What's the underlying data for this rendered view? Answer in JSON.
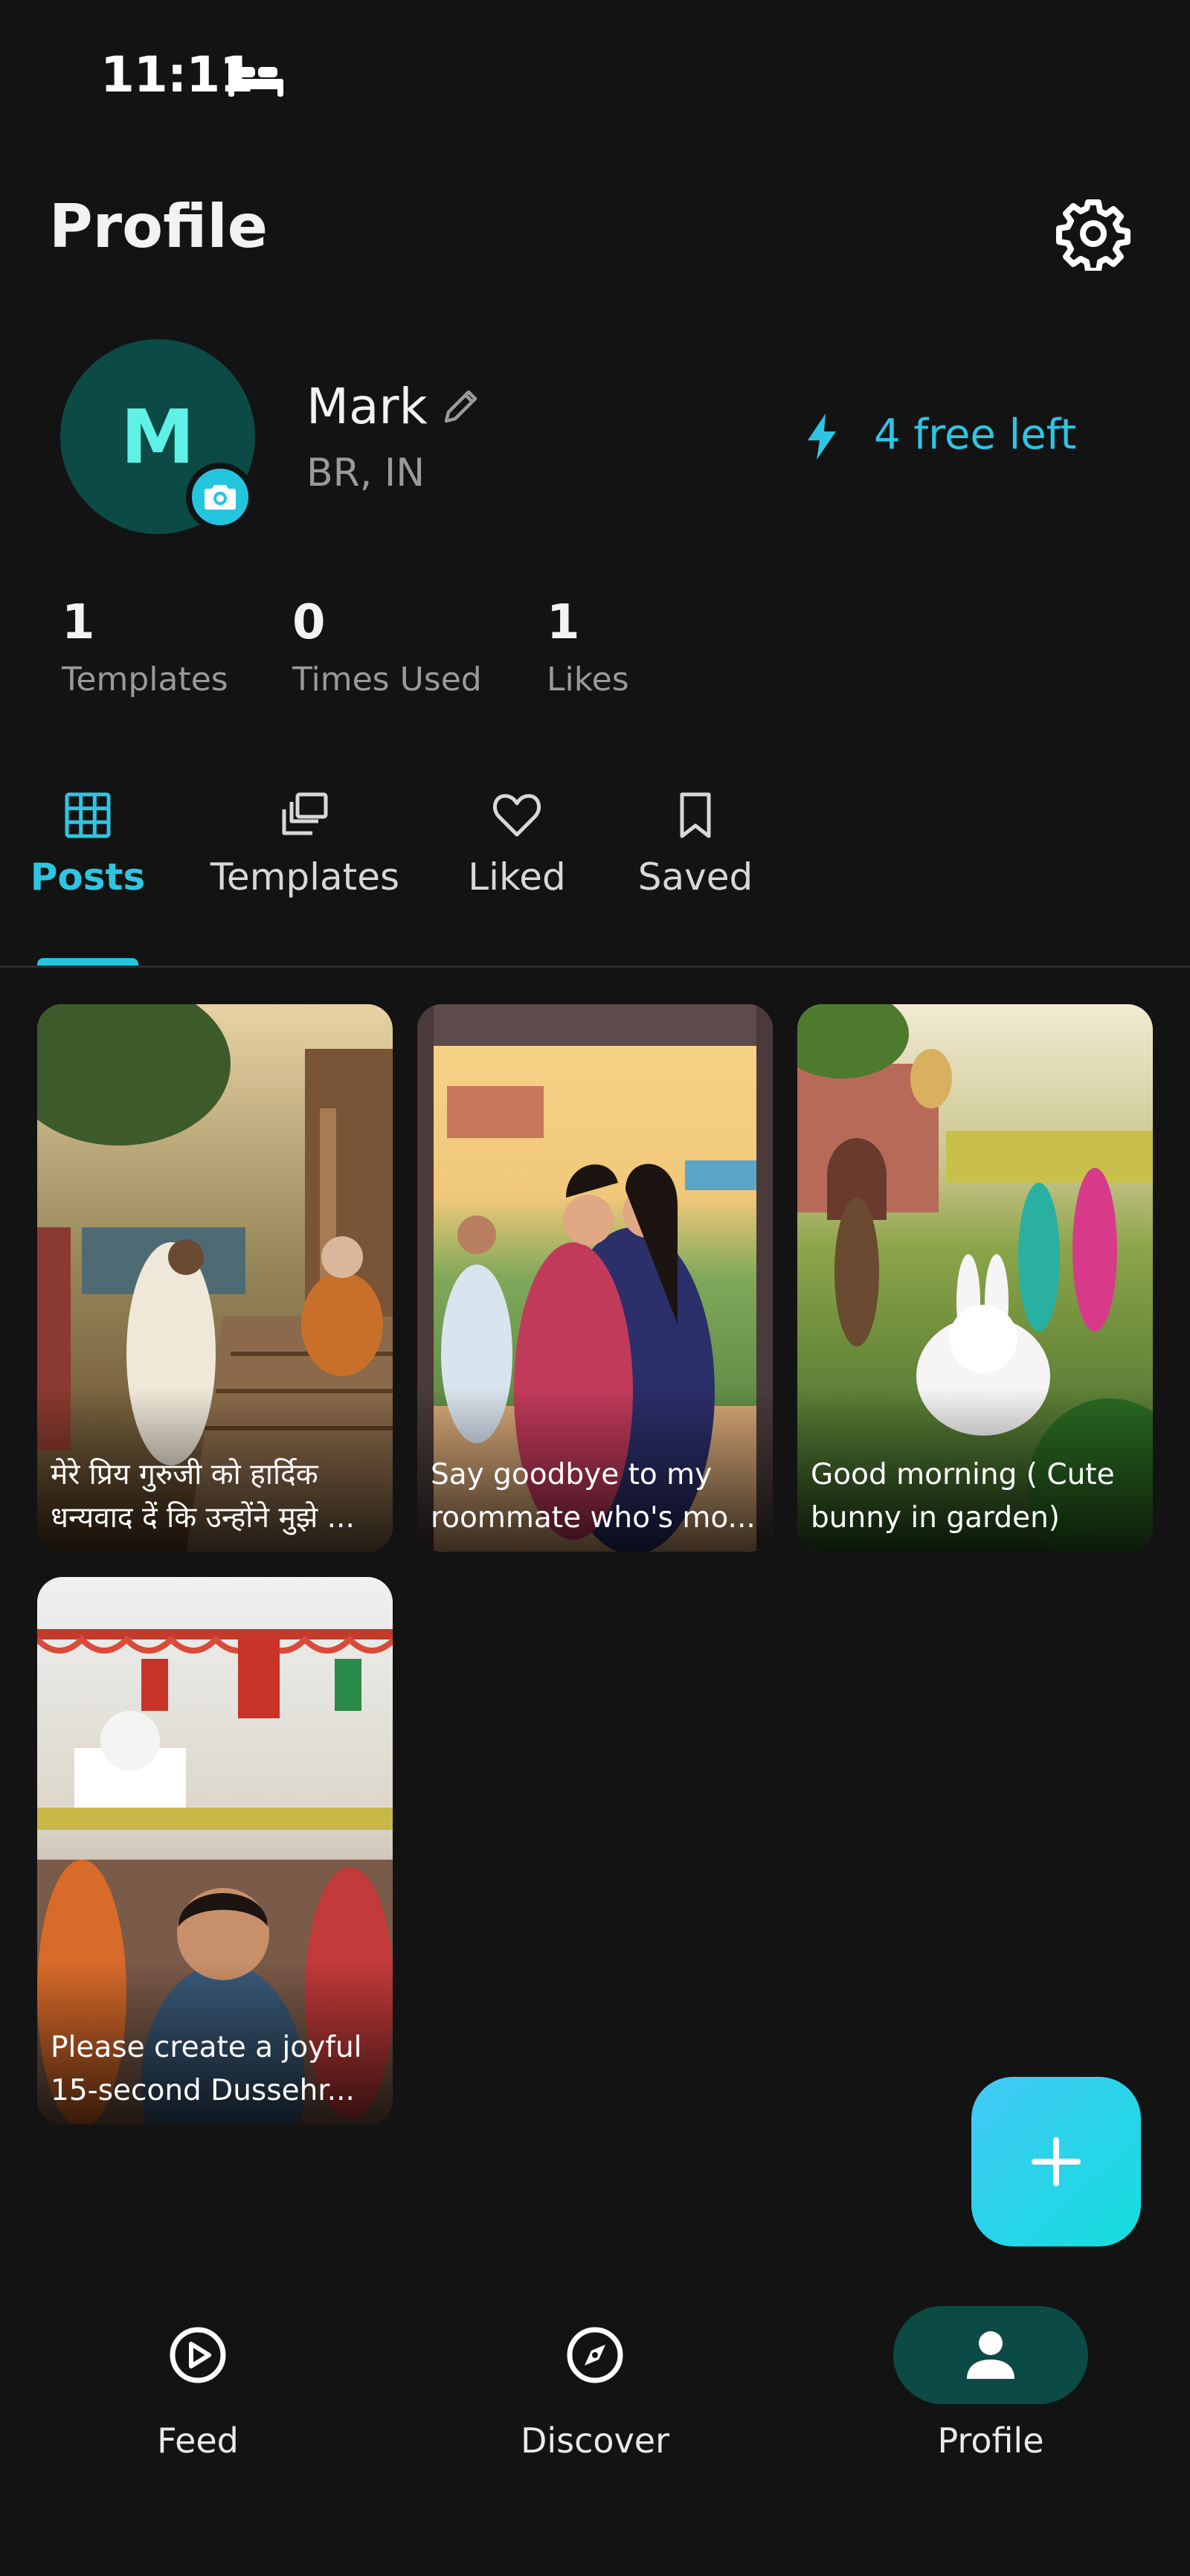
{
  "status_bar": {
    "time": "11:11"
  },
  "header": {
    "title": "Profile"
  },
  "profile": {
    "avatar_initial": "M",
    "name": "Mark",
    "location": "BR, IN",
    "credits": "4 free left"
  },
  "stats": [
    {
      "value": "1",
      "label": "Templates"
    },
    {
      "value": "0",
      "label": "Times Used"
    },
    {
      "value": "1",
      "label": "Likes"
    }
  ],
  "tabs": [
    {
      "label": "Posts",
      "icon": "grid-icon",
      "active": true
    },
    {
      "label": "Templates",
      "icon": "stack-icon",
      "active": false
    },
    {
      "label": "Liked",
      "icon": "heart-icon",
      "active": false
    },
    {
      "label": "Saved",
      "icon": "bookmark-icon",
      "active": false
    }
  ],
  "posts": [
    {
      "caption": "मेरे प्रिय गुरुजी को हार्दिक\nधन्यवाद दें कि उन्होंने मुझे ..."
    },
    {
      "caption": "Say goodbye to my\nroommate who's mo..."
    },
    {
      "caption": "Good morning ( Cute\nbunny in garden)"
    },
    {
      "caption": "Please create a joyful\n15-second Dussehr..."
    }
  ],
  "bottom_nav": [
    {
      "label": "Feed",
      "icon": "play-circle-icon",
      "active": false
    },
    {
      "label": "Discover",
      "icon": "compass-icon",
      "active": false
    },
    {
      "label": "Profile",
      "icon": "person-icon",
      "active": true
    }
  ],
  "colors": {
    "accent": "#23c5dc",
    "background": "#131314",
    "active_nav": "#0b4a45"
  }
}
